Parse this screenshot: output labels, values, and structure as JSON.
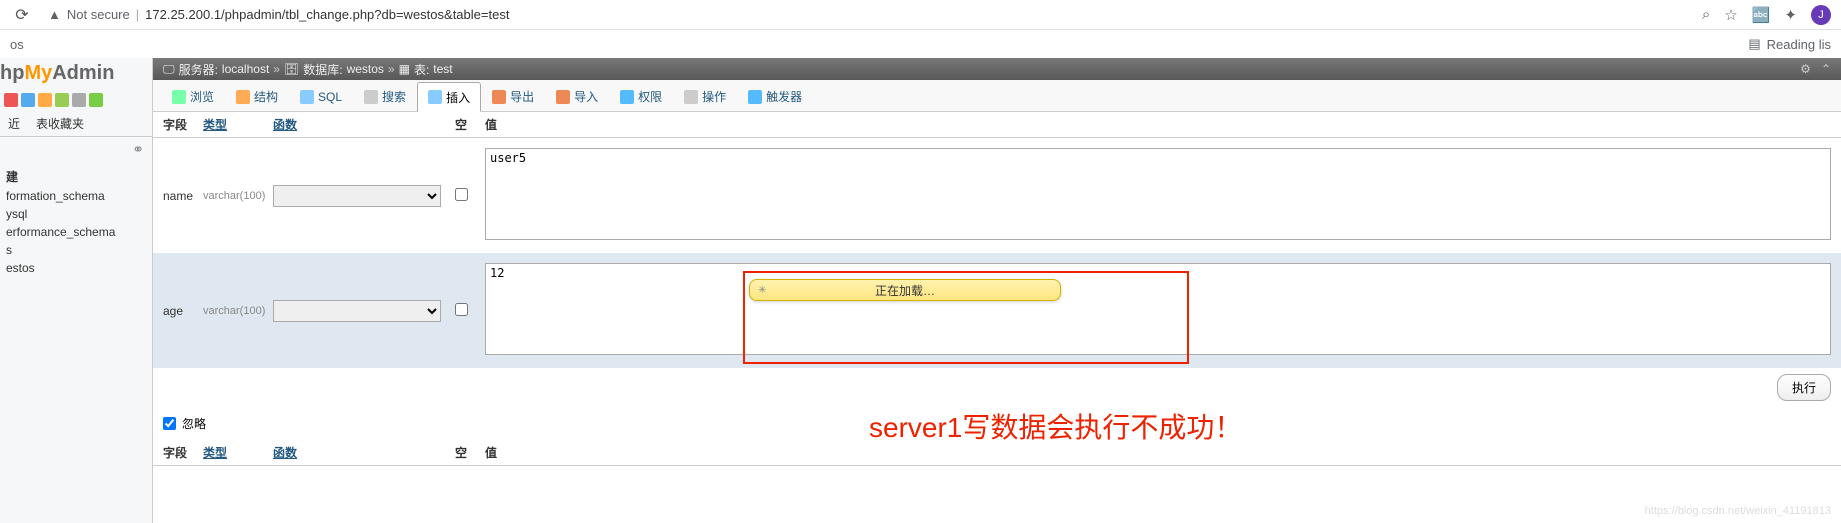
{
  "browser": {
    "not_secure_label": "Not secure",
    "url": "172.25.200.1/phpadmin/tbl_change.php?db=westos&table=test",
    "reading_list": "Reading lis",
    "bookmark_left": "os",
    "avatar_letter": "J"
  },
  "logo": {
    "p1": "hp",
    "p2": "My",
    "p3": "Admin"
  },
  "sidebar": {
    "tab_recent": "近",
    "tab_fav": "表收藏夹",
    "new": "建",
    "items": [
      "formation_schema",
      "ysql",
      "erformance_schema",
      "s",
      "estos"
    ]
  },
  "breadcrumb": {
    "server_label": "服务器:",
    "server_val": "localhost",
    "db_label": "数据库:",
    "db_val": "westos",
    "table_label": "表:",
    "table_val": "test",
    "sep": "»"
  },
  "tabs": {
    "browse": "浏览",
    "structure": "结构",
    "sql": "SQL",
    "search": "搜索",
    "insert": "插入",
    "export": "导出",
    "import": "导入",
    "privileges": "权限",
    "operations": "操作",
    "triggers": "触发器"
  },
  "headers": {
    "field": "字段",
    "type": "类型",
    "function": "函数",
    "null": "空",
    "value": "值"
  },
  "rows": [
    {
      "field": "name",
      "type": "varchar(100)",
      "value": "user5"
    },
    {
      "field": "age",
      "type": "varchar(100)",
      "value": "12"
    }
  ],
  "actions": {
    "execute": "执行",
    "ignore": "忽略"
  },
  "loading": "正在加载…",
  "annotation": "server1写数据会执行不成功！",
  "watermark": "https://blog.csdn.net/weixin_41191813"
}
